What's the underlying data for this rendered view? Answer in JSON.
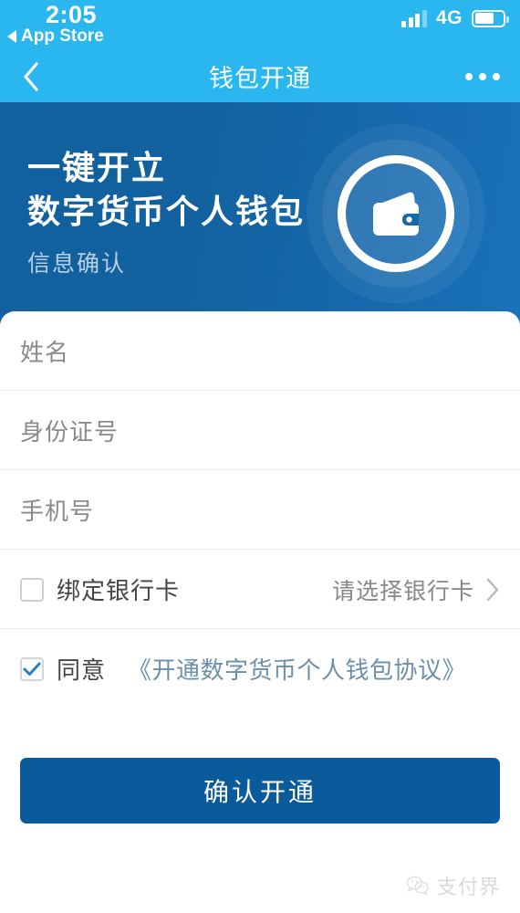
{
  "status_bar": {
    "time": "2:05",
    "return_app": "App Store",
    "network": "4G",
    "battery_percent": 62,
    "signal_bars": 4,
    "signal_active": 3
  },
  "nav": {
    "title": "钱包开通",
    "back_icon": "chevron-left-icon",
    "menu_icon": "more-dots-icon"
  },
  "hero": {
    "line1": "一键开立",
    "line2": "数字货币个人钱包",
    "subtitle": "信息确认",
    "icon": "wallet-icon",
    "bg_start": "#11609f",
    "bg_end": "#1a72ba"
  },
  "form": {
    "fields": [
      {
        "name": "姓名",
        "placeholder": "姓名",
        "value": ""
      },
      {
        "name": "身份证号",
        "placeholder": "身份证号",
        "value": ""
      },
      {
        "name": "手机号",
        "placeholder": "手机号",
        "value": ""
      }
    ],
    "bank_row": {
      "label": "绑定银行卡",
      "checked": false,
      "value": "请选择银行卡",
      "chevron_icon": "chevron-right-icon"
    },
    "agreement_row": {
      "label": "同意",
      "checked": true,
      "link": "《开通数字货币个人钱包协议》",
      "link_color": "#6b90ad",
      "check_icon": "checkmark-icon"
    }
  },
  "submit": {
    "label": "确认开通",
    "color": "#0a5a9c"
  },
  "watermark": {
    "text": "支付界",
    "icon": "wechat-icon"
  }
}
